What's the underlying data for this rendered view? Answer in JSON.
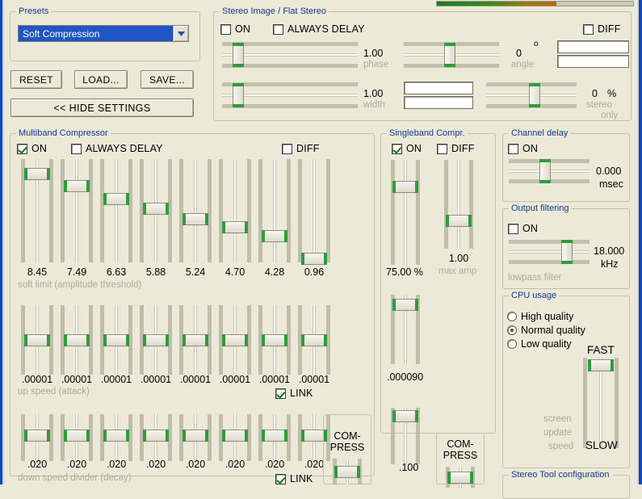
{
  "window": {
    "accent_blue": "#0a46c8",
    "background": "#ece9d8",
    "slider_green": "#2f9c3a"
  },
  "meter": {
    "name": "output-level-meter",
    "level_percent": 61
  },
  "presets": {
    "legend": "Presets",
    "selected": "Soft Compression",
    "buttons": {
      "reset": "RESET",
      "load": "LOAD...",
      "save": "SAVE..."
    },
    "hide_settings": "<< HIDE SETTINGS"
  },
  "stereo_image": {
    "legend": "Stereo Image / Flat Stereo",
    "on_label": "ON",
    "on_checked": false,
    "always_delay_label": "ALWAYS DELAY",
    "always_delay_checked": false,
    "diff_label": "DIFF",
    "diff_checked": false,
    "phase": {
      "value": "1.00",
      "label": "phase",
      "pos_percent": 12
    },
    "width": {
      "value": "1.00",
      "label": "width",
      "pos_percent": 12
    },
    "angle": {
      "value": "0",
      "unit": "o",
      "label": "angle",
      "pos_percent": 48
    },
    "stereo_only": {
      "value": "0",
      "unit": "%",
      "label1": "stereo",
      "label2": "only",
      "pos_percent": 54
    }
  },
  "multiband": {
    "legend": "Multiband Compressor",
    "on_label": "ON",
    "on_checked": true,
    "always_delay_label": "ALWAYS DELAY",
    "always_delay_checked": false,
    "diff_label": "DIFF",
    "diff_checked": false,
    "soft_limit": {
      "caption": "soft limit (amplitude threshold)",
      "values": [
        "8.45",
        "7.49",
        "6.63",
        "5.88",
        "5.24",
        "4.70",
        "4.28",
        "0.96"
      ],
      "positions": [
        14,
        26,
        38,
        48,
        58,
        66,
        74,
        96
      ]
    },
    "up_speed": {
      "caption": "up speed (attack)",
      "values": [
        ".00001",
        ".00001",
        ".00001",
        ".00001",
        ".00001",
        ".00001",
        ".00001",
        ".00001"
      ],
      "positions": [
        50,
        50,
        50,
        50,
        50,
        50,
        50,
        50
      ],
      "link_label": "LINK",
      "link_checked": true
    },
    "down_speed": {
      "caption": "down speed divider (decay)",
      "values": [
        ".020",
        ".020",
        ".020",
        ".020",
        ".020",
        ".020",
        ".020",
        ".020"
      ],
      "positions": [
        44,
        44,
        44,
        44,
        44,
        44,
        44,
        44
      ],
      "link_label": "LINK",
      "link_checked": true
    },
    "compress_label_line1": "COM-",
    "compress_label_line2": "PRESS",
    "compress_pos_percent": 50
  },
  "singleband": {
    "legend": "Singleband Compr.",
    "on_label": "ON",
    "on_checked": true,
    "diff_label": "DIFF",
    "diff_checked": false,
    "threshold": {
      "value": "75.00",
      "unit": "%",
      "pos_percent": 25
    },
    "max_amp": {
      "value": "1.00",
      "label": "max amp",
      "pos_percent": 68
    },
    "attack": {
      "value": ".000090",
      "pos_percent": 14
    },
    "decay": {
      "value": ".100",
      "pos_percent": 14
    },
    "compress_label_line1": "COM-",
    "compress_label_line2": "PRESS",
    "compress_pos_percent": 50
  },
  "channel_delay": {
    "legend": "Channel delay",
    "on_label": "ON",
    "on_checked": false,
    "value": "0.000",
    "unit": "msec",
    "pos_percent": 45
  },
  "output_filtering": {
    "legend": "Output filtering",
    "on_label": "ON",
    "on_checked": false,
    "value": "18.000",
    "unit": "kHz",
    "caption": "lowpass filter",
    "pos_percent": 72
  },
  "cpu_usage": {
    "legend": "CPU usage",
    "options": [
      "High quality",
      "Normal quality",
      "Low quality"
    ],
    "selected_index": 1,
    "fast_label": "FAST",
    "slow_label": "SLOW",
    "caption_line1": "screen",
    "caption_line2": "update",
    "caption_line3": "speed",
    "pos_percent": 8
  },
  "stereo_tool_config": {
    "legend": "Stereo Tool configuration"
  }
}
